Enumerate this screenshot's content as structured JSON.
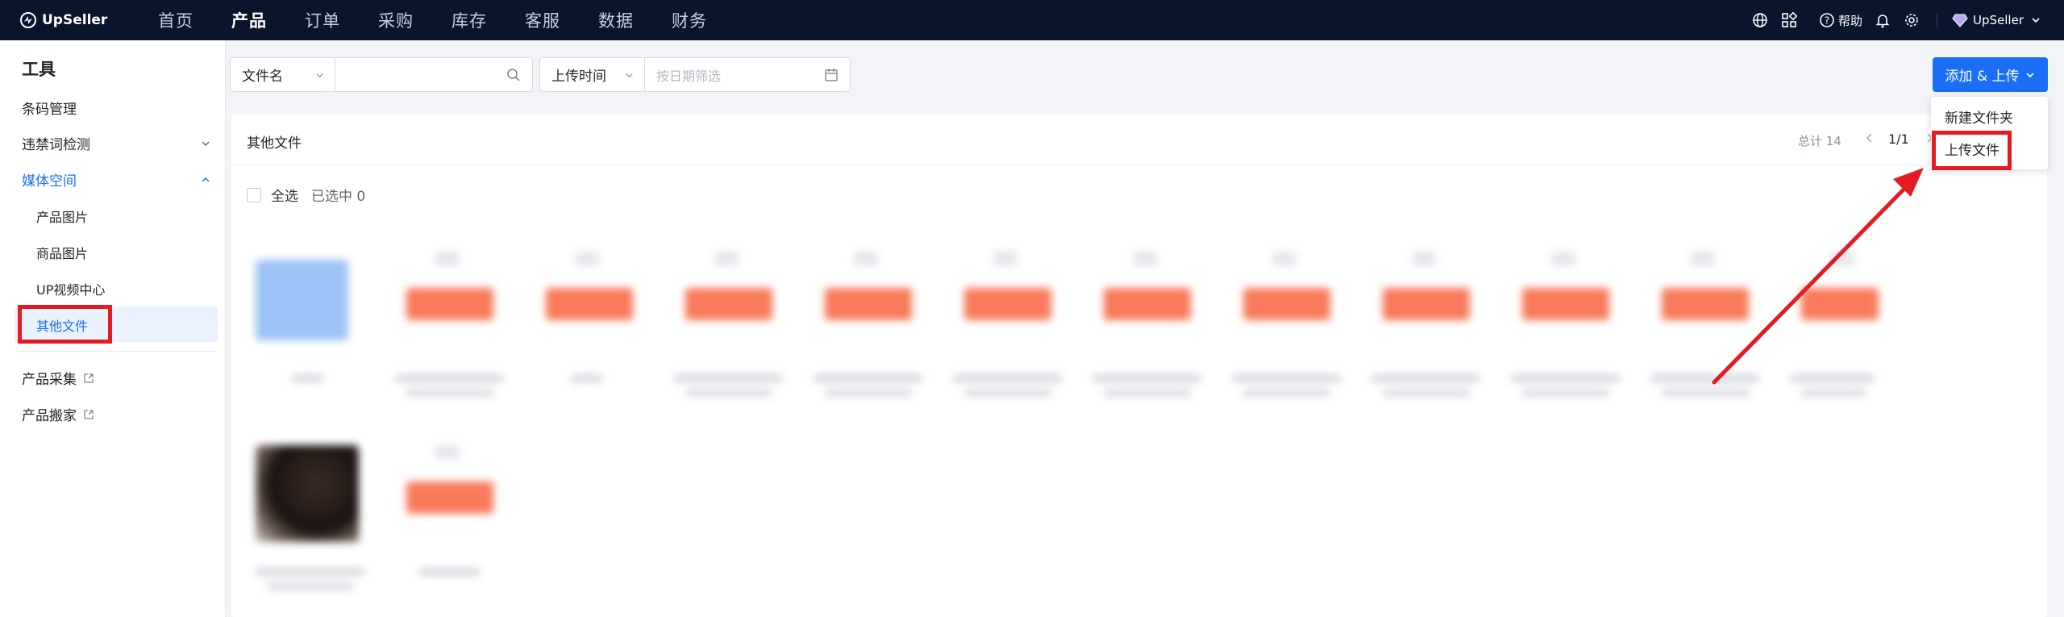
{
  "topnav": {
    "brand": "UpSeller",
    "items": [
      {
        "label": "首页",
        "active": false
      },
      {
        "label": "产品",
        "active": true
      },
      {
        "label": "订单",
        "active": false
      },
      {
        "label": "采购",
        "active": false
      },
      {
        "label": "库存",
        "active": false
      },
      {
        "label": "客服",
        "active": false
      },
      {
        "label": "数据",
        "active": false
      },
      {
        "label": "财务",
        "active": false
      }
    ],
    "help_label": "帮助",
    "user_label": "UpSeller"
  },
  "sidebar": {
    "title": "工具",
    "items": {
      "barcode": "条码管理",
      "banned_words": "违禁词检测",
      "media_space": "媒体空间",
      "product_images": "产品图片",
      "goods_images": "商品图片",
      "up_video": "UP视频中心",
      "other_files": "其他文件",
      "product_collect": "产品采集",
      "product_move": "产品搬家"
    }
  },
  "filters": {
    "field_select": "文件名",
    "search_placeholder": "",
    "time_select": "上传时间",
    "date_placeholder": "按日期筛选"
  },
  "actions": {
    "add_upload": "添加 & 上传",
    "menu": {
      "new_folder": "新建文件夹",
      "upload_file": "上传文件"
    }
  },
  "content": {
    "title": "其他文件",
    "total": "总计 14",
    "page": "1/1",
    "select_all": "全选",
    "selected": "已选中 0"
  },
  "colors": {
    "nav_bg": "#08152b",
    "primary": "#1a6ef5",
    "highlight": "#e51b23"
  }
}
